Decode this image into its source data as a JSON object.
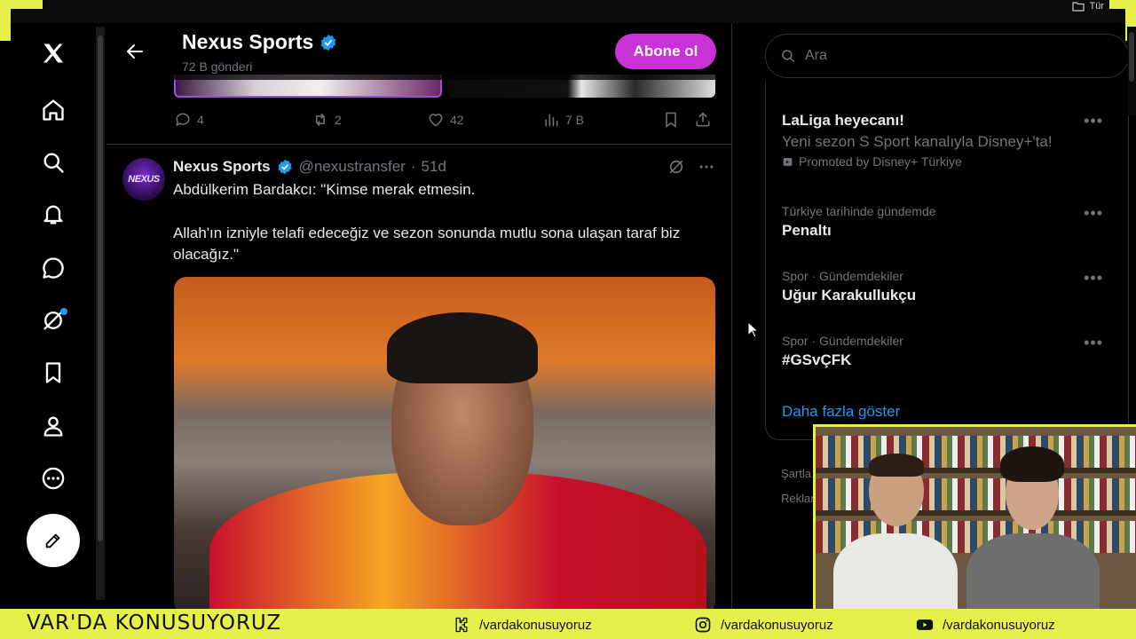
{
  "top": {
    "folder_label": "Tür"
  },
  "nav": {
    "items": [
      "x-logo",
      "home",
      "explore",
      "notifications",
      "messages",
      "grok",
      "bookmarks",
      "profile",
      "more"
    ],
    "compose": "compose"
  },
  "header": {
    "title": "Nexus Sports",
    "subtitle": "72 B gönderi",
    "subscribe_label": "Abone ol"
  },
  "prev_tweet": {
    "replies": "4",
    "retweets": "2",
    "likes": "42",
    "views": "7 B"
  },
  "tweet": {
    "avatar_text": "NEXUS",
    "name": "Nexus Sports",
    "handle": "@nexustransfer",
    "separator": "·",
    "time": "51d",
    "line1": "Abdülkerim Bardakcı: \"Kimse merak etmesin.",
    "line2": "Allah'ın izniyle telafi edeceğiz ve sezon sonunda mutlu sona ulaşan taraf biz olacağız.\""
  },
  "search": {
    "placeholder": "Ara"
  },
  "trends": [
    {
      "title": "LaLiga heyecanı!",
      "desc": "Yeni sezon S Sport kanalıyla Disney+'ta!",
      "promo": "Promoted by Disney+ Türkiye"
    },
    {
      "context": "Türkiye tarihinde gündemde",
      "title": "Penaltı"
    },
    {
      "context": "Spor · Gündemdekiler",
      "title": "Uğur Karakullukçu"
    },
    {
      "context": "Spor · Gündemdekiler",
      "title": "#GSvÇFK"
    }
  ],
  "show_more": "Daha fazla göster",
  "footer": {
    "terms": "Şartla",
    "ads": "Reklar"
  },
  "banner": {
    "brand": "VAR'DA KONUSUYORUZ",
    "kick": "/vardakonusuyoruz",
    "instagram": "/vardakonusuyoruz",
    "youtube": "/vardakonusuyoruz"
  },
  "colors": {
    "accent": "#1d9bf0",
    "subscribe": "#c932d6",
    "banner": "#e6f04a"
  }
}
